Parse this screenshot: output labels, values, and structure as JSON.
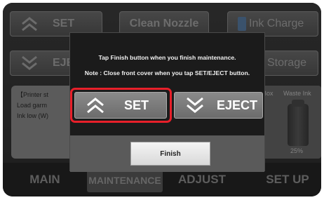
{
  "background": {
    "buttons": {
      "set": "SET",
      "eject": "EJE",
      "clean": "Clean Nozzle",
      "ink_charge": "Ink Charge",
      "storage": "ng Storage"
    },
    "status": {
      "line1": "【Printer st",
      "line2": "Load garm",
      "line3": "Ink low (W)"
    },
    "right_panel": {
      "box_label": "Box",
      "waste_label": "Waste Ink",
      "waste_level": "25%"
    }
  },
  "tabs": {
    "main": "MAIN",
    "maintenance": "MAINTENANCE",
    "adjust": "ADJUST",
    "setup": "SET UP"
  },
  "dialog": {
    "message1": "Tap Finish button when you finish maintenance.",
    "message2": "Note : Close front cover when you tap SET/EJECT button.",
    "set_label": "SET",
    "eject_label": "EJECT",
    "finish_label": "Finish"
  },
  "colors": {
    "highlight": "#e8202a",
    "ink_cartridge": "#5a7fa6"
  },
  "icons": {
    "set": "double-chevron-up-icon",
    "eject": "double-chevron-down-icon"
  }
}
